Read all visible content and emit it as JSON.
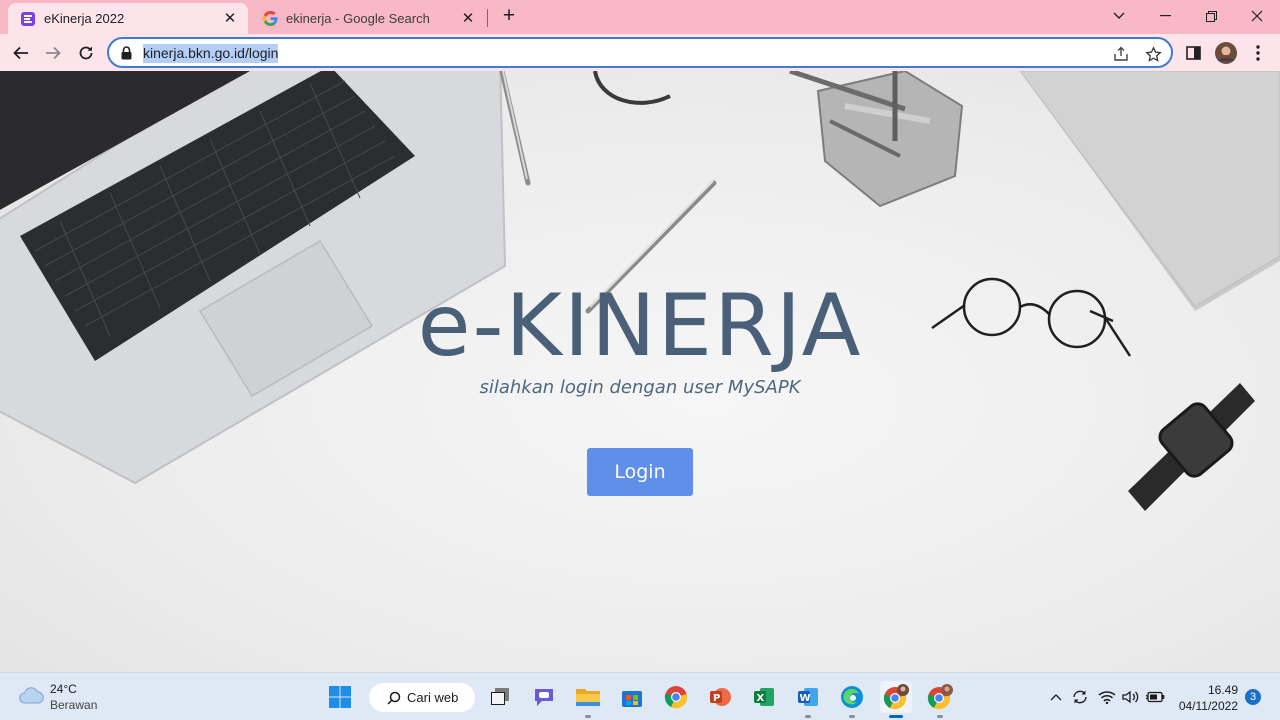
{
  "browser": {
    "tabs": [
      {
        "title": "eKinerja 2022",
        "active": true
      },
      {
        "title": "ekinerja - Google Search",
        "active": false
      }
    ],
    "address": {
      "url": "kinerja.bkn.go.id/login"
    },
    "colors": {
      "frame": "#f9b8c5",
      "toolbar": "#fde4ea",
      "focus_ring": "#3d7bd6"
    }
  },
  "page": {
    "title": "e-KINERJA",
    "subtitle": "silahkan login dengan user MySAPK",
    "login_label": "Login",
    "colors": {
      "title": "#4a6079",
      "button": "#5f8fe9"
    }
  },
  "taskbar": {
    "weather": {
      "temp": "24°C",
      "condition": "Berawan"
    },
    "search_label": "Cari web",
    "apps": [
      "start",
      "search",
      "task-view",
      "teams-chat",
      "file-explorer",
      "store",
      "chrome",
      "powerpoint",
      "excel",
      "word",
      "edge",
      "chrome-profile-1",
      "chrome-profile-2"
    ],
    "clock": {
      "time": "16.49",
      "date": "04/11/2022"
    },
    "notifications": "3"
  }
}
